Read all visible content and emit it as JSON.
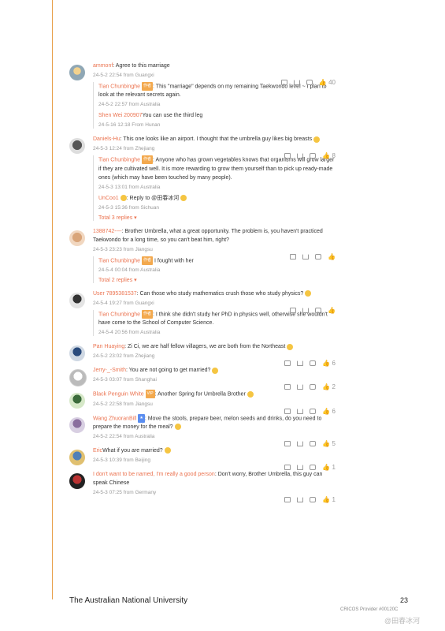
{
  "comments": [
    {
      "user": "ammonf",
      "text": ": Agree to this marriage",
      "meta": "24-5-2 22:54 from Guangxi",
      "likes": "40",
      "replies": [
        {
          "user": "Tian Chunbinghe",
          "tag": "作者",
          "text": ": This \"marriage\" depends on my remaining Taekwondo level ~ I plan to look at the relevant secrets again.",
          "meta": "24-5-2 22:57 from Australia"
        },
        {
          "user": "Shen Wei 200907",
          "tag": "",
          "text": "You can use the third leg",
          "meta": "24-5-16 12:18 From Hunan"
        }
      ],
      "more": ""
    },
    {
      "user": "Daniels-Hu",
      "text": ": This one looks like an airport. I thought that the umbrella guy likes big breasts",
      "meta": "24-5-3 12:24 from Zhejiang",
      "likes": "8",
      "replies": [
        {
          "user": "Tian Chunbinghe",
          "tag": "作者",
          "text": ": Anyone who has grown vegetables knows that organisms will grow larger if they are cultivated well. It is more rewarding to grow them yourself than to pick up ready-made ones (which may have been touched by many people).",
          "meta": "24-5-3 13:01 from Australia"
        },
        {
          "user": "UnCoo1",
          "tag": "",
          "text": ": Reply to @田春冰河",
          "meta": "24-5-3 15:36 from Sichuan"
        }
      ],
      "more": "Total 3 replies"
    },
    {
      "user": "1388742----",
      "text": ": Brother Umbrella, what a great opportunity. The problem is, you haven't practiced Taekwondo for a long time, so you can't beat him, right?",
      "meta": "24-5-3 23:23 from Jiangsu",
      "likes": "",
      "replies": [
        {
          "user": "Tian Chunbinghe",
          "tag": "作者",
          "text": "I fought with her",
          "meta": "24-5-4 00:04 from Australia"
        }
      ],
      "more": "Total 2 replies"
    },
    {
      "user": "User 7895381537",
      "text": ": Can those who study mathematics crush those who study physics?",
      "meta": "24-5-4 19:27 from Guangxi",
      "likes": "",
      "replies": [
        {
          "user": "Tian Chunbinghe",
          "tag": "作者",
          "text": ": I think she didn't study her PhD in physics well, otherwise she wouldn't have come to the School of Computer Science.",
          "meta": "24-5-4 20:56 from Australia"
        }
      ],
      "more": ""
    },
    {
      "user": "Pan Huaying",
      "text": ": Zi Ci, we are half fellow villagers, we are both from the Northeast",
      "meta": "24-5-2 23:02 from Zhejiang",
      "likes": "6",
      "replies": [],
      "more": ""
    },
    {
      "user": "Jerry-_-Smith",
      "text": ": You are not going to get married?",
      "meta": "24-5-3 03:07 from Shanghai",
      "likes": "2",
      "replies": [],
      "more": ""
    },
    {
      "user": "Black Penguin White",
      "text": ": Another Spring for Umbrella Brother",
      "meta": "24-5-2 22:58 from Jiangsu",
      "likes": "6",
      "replies": [],
      "more": ""
    },
    {
      "user": "Wang ZhuoranBill",
      "text": ": Move the stools, prepare beer, melon seeds and drinks, do you need to prepare the money for the meal?",
      "meta": "24-5-2 22:54 from Australia",
      "likes": "5",
      "replies": [],
      "more": ""
    },
    {
      "user": "Eric",
      "text": "What if you are married?",
      "meta": "24-5-3 10:39 from Beijing",
      "likes": "1",
      "replies": [],
      "more": ""
    },
    {
      "user": "I don't want to be named, I'm really a good person",
      "text": ": Don't worry, Brother Umbrella, this guy can speak Chinese",
      "meta": "24-5-3 07:25 from Germany",
      "likes": "1",
      "replies": [],
      "more": ""
    }
  ],
  "footer": {
    "university": "The Australian National University",
    "page": "23",
    "cricos": "CRICOS Provider #00120C",
    "watermark": "@田春冰河"
  }
}
